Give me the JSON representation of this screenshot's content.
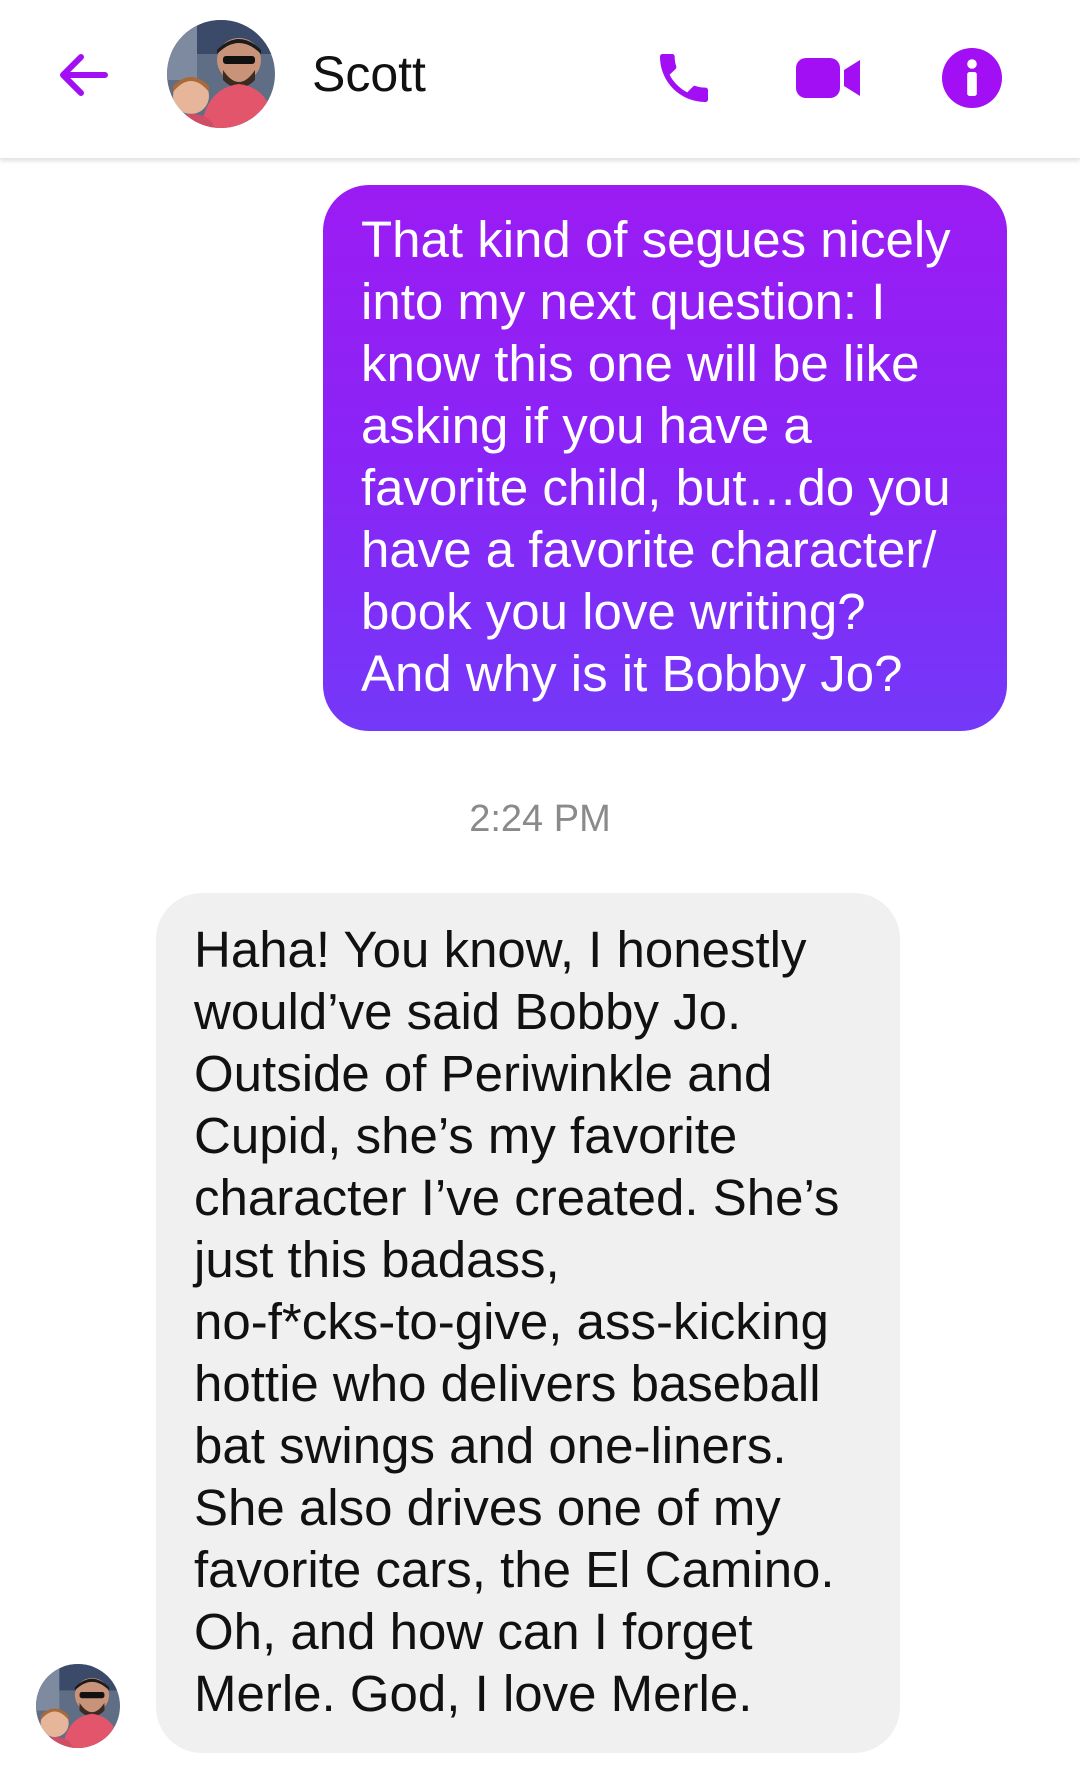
{
  "header": {
    "contact_name": "Scott",
    "back_icon": "arrow-left-icon",
    "call_icon": "phone-icon",
    "video_icon": "video-camera-icon",
    "info_icon": "info-icon"
  },
  "colors": {
    "accent": "#a20ff4",
    "sent_bubble_top": "#9b1cf3",
    "sent_bubble_bottom": "#7438f8",
    "received_bubble": "#f0f0f0"
  },
  "messages": [
    {
      "direction": "sent",
      "text": "That kind of segues nicely\ninto my next question: I\nknow this one will be like\nasking if you have a\nfavorite child, but…do you\nhave a favorite character/\nbook you love writing?\nAnd why is it Bobby Jo?"
    },
    {
      "direction": "received",
      "text": "Haha! You know, I honestly\nwould’ve said Bobby Jo.\nOutside of Periwinkle and\nCupid, she’s my favorite\ncharacter I’ve created. She’s\njust this badass,\nno-f*cks-to-give, ass-kicking\nhottie who delivers baseball\nbat swings and one-liners.\nShe also drives one of my\nfavorite cars, the El Camino.\nOh, and how can I forget\nMerle. God, I love Merle."
    }
  ],
  "timestamp": "2:24 PM"
}
